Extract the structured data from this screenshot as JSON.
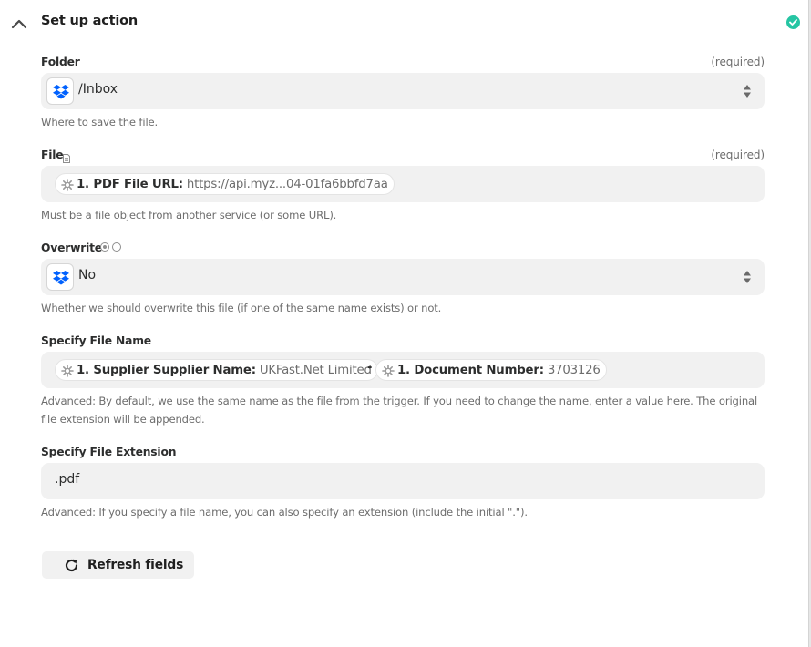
{
  "header": {
    "title": "Set up action",
    "collapse_icon": "chevron-up-icon",
    "status_icon": "check-circle-icon",
    "status_color": "#26c5a3"
  },
  "fields": {
    "folder": {
      "label": "Folder",
      "required": "(required)",
      "app_icon": "dropbox-icon",
      "value": "/Inbox",
      "help": "Where to save the file."
    },
    "file": {
      "label": "File",
      "label_icon": "document-icon",
      "required": "(required)",
      "pill": {
        "icon": "gear-icon",
        "key": "1. PDF File URL:",
        "value": "https://api.myz...04-01fa6bbfd7aa"
      },
      "help": "Must be a file object from another service (or some URL)."
    },
    "overwrite": {
      "label": "Overwrite",
      "label_icon": "radio-icon",
      "app_icon": "dropbox-icon",
      "value": "No",
      "help": "Whether we should overwrite this file (if one of the same name exists) or not."
    },
    "file_name": {
      "label": "Specify File Name",
      "pills": [
        {
          "icon": "gear-icon",
          "key": "1. Supplier Supplier Name:",
          "value": "UKFast.Net Limited"
        },
        {
          "icon": "gear-icon",
          "key": "1. Document Number:",
          "value": "3703126"
        }
      ],
      "separator": "-",
      "help_line1": "Advanced: By default, we use the same name as the file from the trigger. If you need to change the name, enter a value here. The original",
      "help_line2": "file extension will be appended."
    },
    "file_extension": {
      "label": "Specify File Extension",
      "value": ".pdf",
      "help": "Advanced: If you specify a file name, you can also specify an extension (include the initial \".\")."
    }
  },
  "refresh_button": {
    "label": "Refresh fields",
    "icon": "refresh-icon"
  },
  "colors": {
    "accent_success": "#26c5a3",
    "dropbox_blue": "#0061fe",
    "field_background": "#f1f1f1"
  }
}
